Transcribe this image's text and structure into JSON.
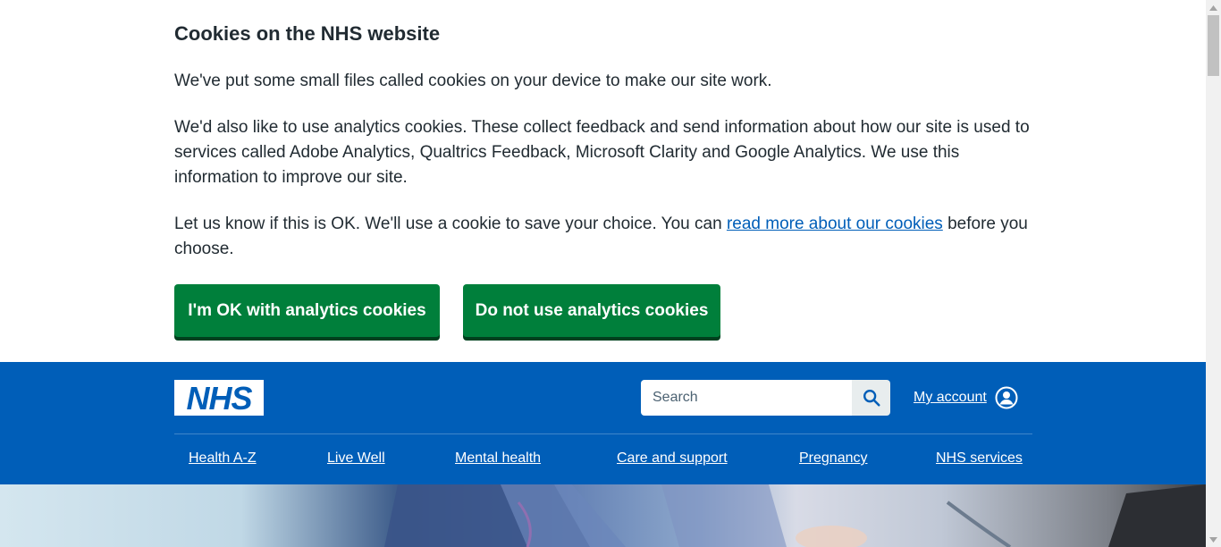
{
  "cookie_banner": {
    "title": "Cookies on the NHS website",
    "paragraph_1": "We've put some small files called cookies on your device to make our site work.",
    "paragraph_2": "We'd also like to use analytics cookies. These collect feedback and send information about how our site is used to services called Adobe Analytics, Qualtrics Feedback, Microsoft Clarity and Google Analytics. We use this information to improve our site.",
    "paragraph_3_before_link": "Let us know if this is OK. We'll use a cookie to save your choice. You can ",
    "paragraph_3_link": "read more about our cookies",
    "paragraph_3_after_link": " before you choose.",
    "accept_button": "I'm OK with analytics cookies",
    "reject_button": "Do not use analytics cookies"
  },
  "header": {
    "logo_text": "NHS",
    "search": {
      "placeholder": "Search"
    },
    "account_label": "My account",
    "nav": [
      "Health A-Z",
      "Live Well",
      "Mental health",
      "Care and support",
      "Pregnancy",
      "NHS services"
    ]
  },
  "icons": {
    "search": "search-icon",
    "account": "user-circle-icon"
  },
  "colors": {
    "nhs_blue": "#005eb8",
    "button_green": "#007f3b",
    "button_shadow": "#00401e",
    "link_blue": "#005eb8",
    "text": "#212b32"
  }
}
